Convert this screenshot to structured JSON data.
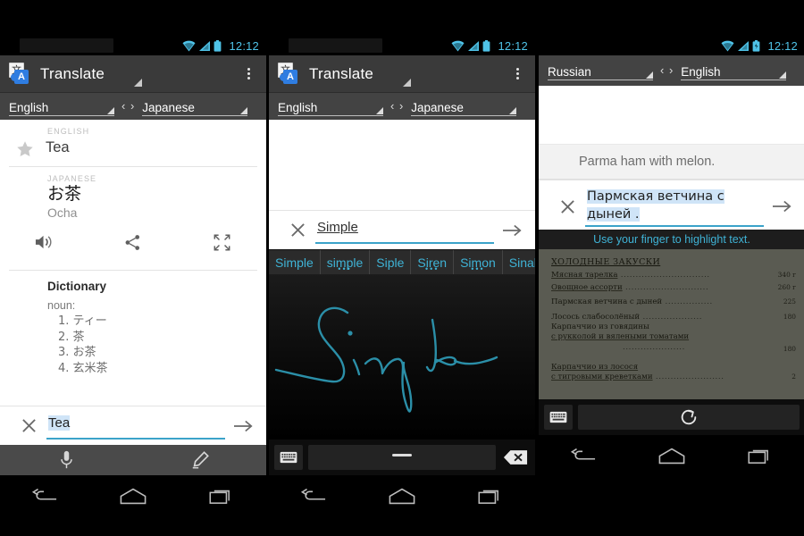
{
  "meta": {
    "device_count": 3,
    "status_time": "12:12",
    "accent_cyan": "#3fb3d6",
    "status_icon_color": "#4fc3e8"
  },
  "panel1": {
    "app": {
      "title": "Translate",
      "logo_left_char": "文",
      "logo_right_char": "A"
    },
    "languages": {
      "source": "English",
      "target": "Japanese",
      "swap_symbol": "‹ ›"
    },
    "result": {
      "source_label": "ENGLISH",
      "source_text": "Tea",
      "target_label": "JAPANESE",
      "target_text": "お茶",
      "romanization": "Ocha",
      "actions": [
        "speaker-icon",
        "share-icon",
        "fullscreen-icon"
      ]
    },
    "dictionary": {
      "heading": "Dictionary",
      "part_of_speech": "noun:",
      "entries": [
        "1. ティー",
        "2. 茶",
        "3. お茶",
        "4. 玄米茶"
      ]
    },
    "input": {
      "value": "Tea",
      "clear_label": "✕",
      "submit_label": "→"
    },
    "input_methods": [
      "microphone-icon",
      "handwriting-pen-icon"
    ],
    "navbar": [
      "back-icon",
      "home-icon",
      "recents-icon"
    ]
  },
  "panel2": {
    "app": {
      "title": "Translate",
      "logo_left_char": "文",
      "logo_right_char": "A"
    },
    "languages": {
      "source": "English",
      "target": "Japanese",
      "swap_symbol": "‹ ›"
    },
    "input": {
      "value": "Simple",
      "clear_label": "✕",
      "submit_label": "→"
    },
    "suggestions": [
      {
        "text": "Simple",
        "has_dots": false
      },
      {
        "text": "simple",
        "has_dots": true
      },
      {
        "text": "Siple",
        "has_dots": false
      },
      {
        "text": "Siren",
        "has_dots": true
      },
      {
        "text": "Simon",
        "has_dots": true
      },
      {
        "text": "Sinale",
        "has_dots": false
      }
    ],
    "handwriting": {
      "stroke_text": "Simple",
      "stroke_color": "#2b8fa8"
    },
    "keyboard_bar": [
      "keyboard-icon",
      "space-key",
      "backspace-icon"
    ],
    "navbar": [
      "back-icon",
      "home-icon",
      "recents-icon"
    ]
  },
  "panel3": {
    "languages": {
      "source": "Russian",
      "target": "English",
      "swap_symbol": "‹ ›"
    },
    "translation": "Parma ham with melon.",
    "input": {
      "line1": "Пармская ветчина с",
      "line2": "дыней .",
      "clear_label": "✕",
      "submit_label": "→"
    },
    "hint": "Use your finger to highlight text.",
    "photo": {
      "title": "ХОЛОДНЫЕ ЗАКУСКИ",
      "items": [
        {
          "name": "Мясная тарелка",
          "price": "340 г",
          "highlighted": false
        },
        {
          "name": "Овощное ассорти",
          "price": "260 г",
          "highlighted": false
        },
        {
          "name": "Пармская ветчина с дыней",
          "price": "225",
          "highlighted": true
        },
        {
          "name": "Лосось слабосолёный",
          "price": "180",
          "highlighted": false
        },
        {
          "name": "Карпаччио из говядины",
          "price": "",
          "highlighted": false
        },
        {
          "name": "с рукколой и вялеными томатами",
          "price": "180",
          "highlighted": false
        },
        {
          "name": "Карпаччио из лосося",
          "price": "",
          "highlighted": false
        },
        {
          "name": "с тигровыми креветками",
          "price": "2",
          "highlighted": false
        }
      ]
    },
    "keyboard_bar": [
      "keyboard-icon",
      "retake-refresh-icon"
    ],
    "navbar": [
      "back-icon",
      "home-icon",
      "recents-icon"
    ]
  }
}
